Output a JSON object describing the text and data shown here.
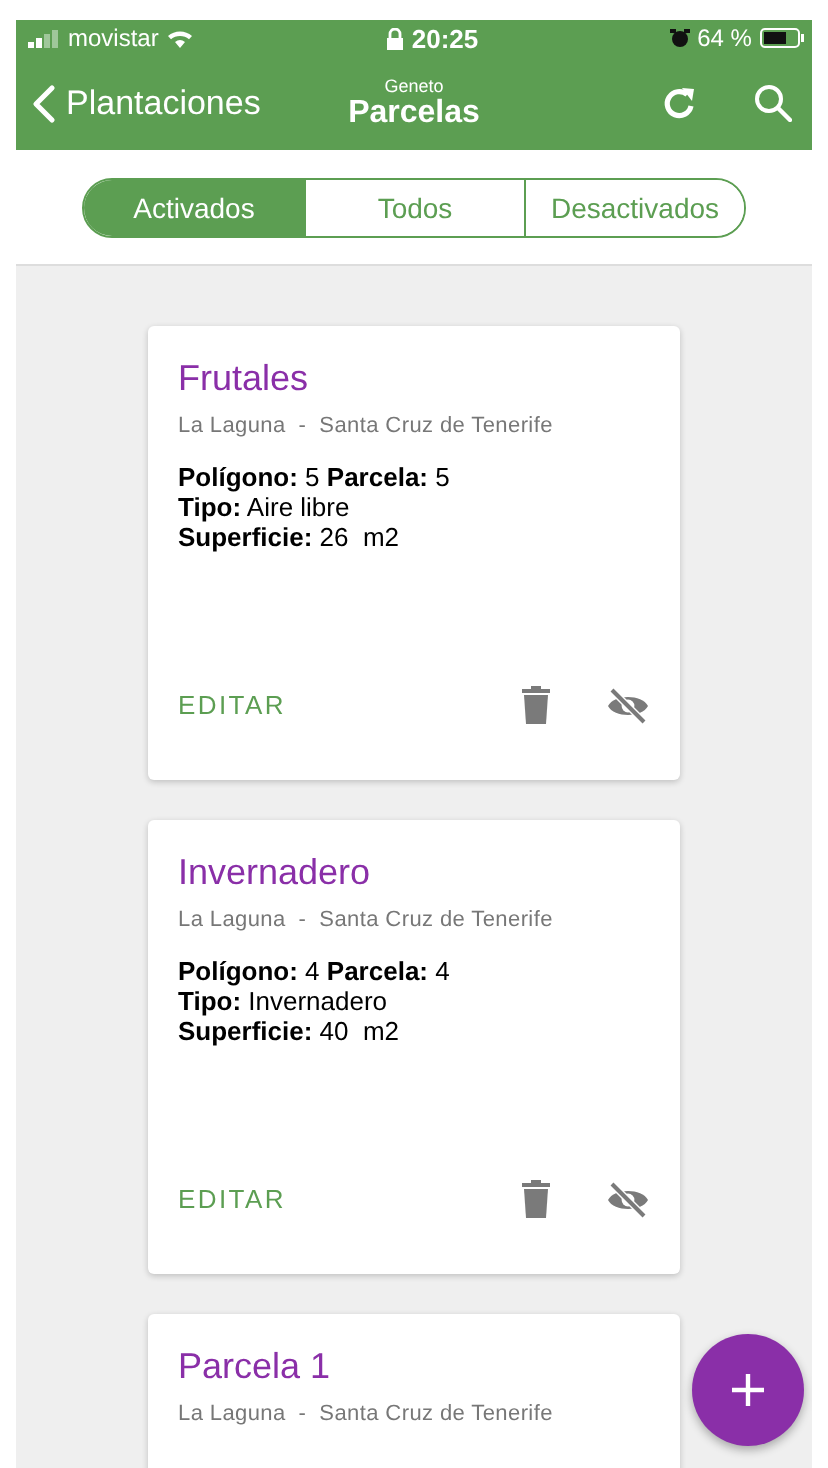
{
  "status_bar": {
    "carrier": "movistar",
    "time": "20:25",
    "battery": "64 %"
  },
  "nav": {
    "back": "Plantaciones",
    "subtitle": "Geneto",
    "title": "Parcelas"
  },
  "segments": [
    {
      "label": "Activados",
      "selected": true
    },
    {
      "label": "Todos",
      "selected": false
    },
    {
      "label": "Desactivados",
      "selected": false
    }
  ],
  "cards": [
    {
      "title": "Frutales",
      "location": "La Laguna  -  Santa Cruz de Tenerife",
      "details": [
        "**Polígono:** 5 **Parcela:** 5",
        "**Tipo:** Aire libre",
        "**Superficie:** 26  m2"
      ],
      "action": "EDITAR"
    },
    {
      "title": "Invernadero",
      "location": "La Laguna  -  Santa Cruz de Tenerife",
      "details": [
        "**Polígono:** 4 **Parcela:** 4",
        "**Tipo:** Invernadero",
        "**Superficie:** 40  m2"
      ],
      "action": "EDITAR"
    },
    {
      "title": "Parcela 1",
      "location": "La Laguna  -  Santa Cruz de Tenerife"
    }
  ]
}
